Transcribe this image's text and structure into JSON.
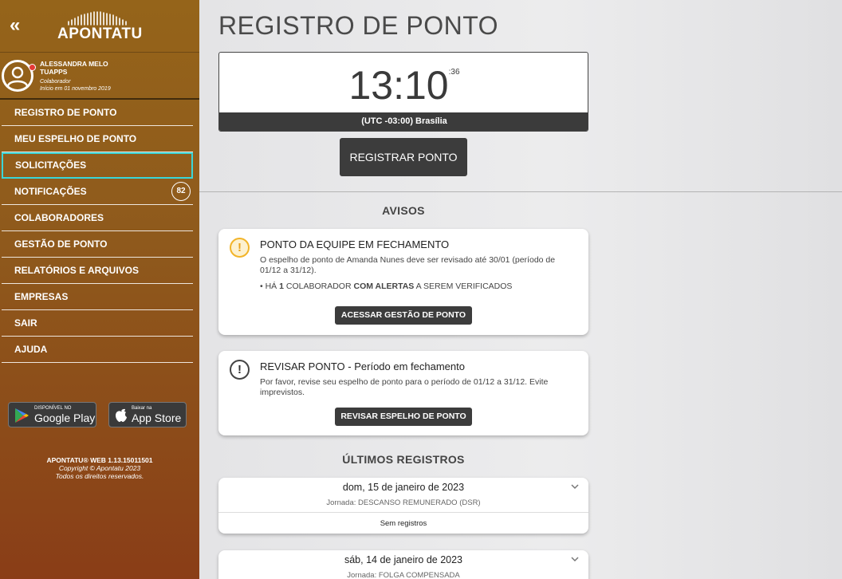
{
  "sidebar": {
    "collapse_glyph": "«",
    "logo_text": "APONTATU",
    "user": {
      "name": "ALESSANDRA MELO",
      "company": "TUAPPS",
      "role": "Colaborador",
      "since": "Início em 01 novembro 2019"
    },
    "menu": [
      {
        "label": "REGISTRO DE PONTO"
      },
      {
        "label": "MEU ESPELHO DE PONTO"
      },
      {
        "label": "SOLICITAÇÕES",
        "active": true
      },
      {
        "label": "NOTIFICAÇÕES",
        "badge": "82"
      },
      {
        "label": "COLABORADORES"
      },
      {
        "label": "GESTÃO DE PONTO"
      },
      {
        "label": "RELATÓRIOS E ARQUIVOS"
      },
      {
        "label": "EMPRESAS"
      },
      {
        "label": "SAIR"
      },
      {
        "label": "AJUDA"
      }
    ],
    "stores": {
      "google_small": "DISPONÍVEL NO",
      "google_big": "Google Play",
      "apple_small": "Baixar na",
      "apple_big": "App Store"
    },
    "footer": {
      "version": "APONTATU® WEB 1.13.15011501",
      "copyright": "Copyright © Apontatu 2023",
      "rights": "Todos os direitos reservados."
    }
  },
  "main": {
    "title": "REGISTRO DE PONTO",
    "clock": {
      "hm": "13:10",
      "sec": ":36",
      "timezone": "(UTC -03:00) Brasília"
    },
    "register_button": "REGISTRAR PONTO",
    "avisos_title": "AVISOS",
    "cards": [
      {
        "icon": "!",
        "title": "PONTO DA EQUIPE EM FECHAMENTO",
        "text": "O espelho de ponto de Amanda Nunes deve ser revisado até 30/01 (período de 01/12 a 31/12).",
        "alert_prefix": "• HÁ ",
        "alert_count": "1",
        "alert_mid": " COLABORADOR ",
        "alert_bold": "COM ALERTAS",
        "alert_suffix": " A SEREM VERIFICADOS",
        "button": "ACESSAR GESTÃO DE PONTO"
      },
      {
        "icon": "!",
        "title": "REVISAR PONTO - Período em fechamento",
        "text": "Por favor, revise seu espelho de ponto para o período de 01/12 a 31/12. Evite imprevistos.",
        "button": "REVISAR ESPELHO DE PONTO"
      }
    ],
    "ultimos_title": "ÚLTIMOS REGISTROS",
    "records": [
      {
        "date": "dom, 15 de janeiro de 2023",
        "journey": "Jornada: DESCANSO REMUNERADO (DSR)",
        "empty": "Sem registros"
      },
      {
        "date": "sáb, 14 de janeiro de 2023",
        "journey": "Jornada: FOLGA COMPENSADA"
      }
    ]
  },
  "colors": {
    "sidebar_top": "#95641a",
    "sidebar_bottom": "#8a3d17",
    "active_outline": "#3ad6d8",
    "dark_button": "#3c3c3c",
    "warning_icon": "#f2b429"
  }
}
